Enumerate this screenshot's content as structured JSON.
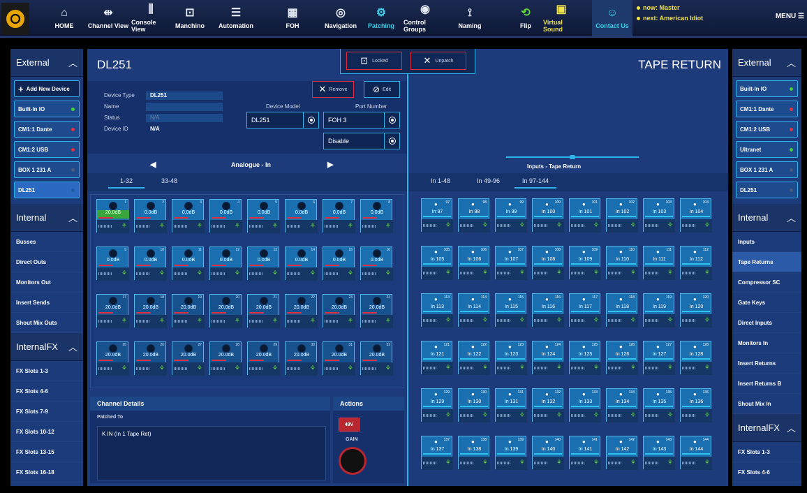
{
  "topbar": {
    "items": [
      {
        "label": "HOME",
        "icon": "home-icon",
        "glyph": "⌂",
        "style": ""
      },
      {
        "label": "Channel View",
        "icon": "channel-view-icon",
        "glyph": "⇹",
        "style": ""
      },
      {
        "label": "Console View",
        "icon": "console-view-icon",
        "glyph": "⫼",
        "style": ""
      },
      {
        "label": "Manchino",
        "icon": "manchino-icon",
        "glyph": "⊡",
        "style": ""
      },
      {
        "label": "Automation",
        "icon": "automation-icon",
        "glyph": "☰",
        "style": ""
      },
      {
        "label": "FOH",
        "icon": "foh-icon",
        "glyph": "▦",
        "style": ""
      },
      {
        "label": "Navigation",
        "icon": "navigation-icon",
        "glyph": "◎",
        "style": ""
      },
      {
        "label": "Patching",
        "icon": "patching-icon",
        "glyph": "⚙",
        "style": "teal"
      },
      {
        "label": "Control Groups",
        "icon": "control-groups-icon",
        "glyph": "◉",
        "style": ""
      },
      {
        "label": "Naming",
        "icon": "naming-icon",
        "glyph": "⟟",
        "style": ""
      },
      {
        "label": "Flip",
        "icon": "flip-icon",
        "glyph": "⟲",
        "style": "green"
      },
      {
        "label": "Virtual Sound",
        "icon": "virtual-sound-icon",
        "glyph": "▣",
        "style": "yellow"
      },
      {
        "label": "Contact Us",
        "icon": "contact-us-icon",
        "glyph": "☺",
        "style": "teal sel"
      }
    ],
    "now_label": "now: Master",
    "next_label": "next: American Idiot",
    "menu_label": "MENU ☰"
  },
  "left_panel": {
    "external_title": "External",
    "add_device": "Add New Device",
    "devices": [
      {
        "label": "Built-In IO",
        "led": "#41d13a"
      },
      {
        "label": "CM1:1 Dante",
        "led": "#e23040"
      },
      {
        "label": "CM1:2 USB",
        "led": "#e23040"
      },
      {
        "label": "BOX 1 231 A",
        "led": "#4a5b7c"
      },
      {
        "label": "DL251",
        "led": "#1f5aa8"
      }
    ],
    "internal_title": "Internal",
    "internal_items": [
      "Busses",
      "Direct Outs",
      "Monitors Out",
      "Insert Sends",
      "Shout Mix Outs"
    ],
    "internalfx_title": "InternalFX",
    "fx_items": [
      "FX Slots 1-3",
      "FX Slots 4-6",
      "FX Slots 7-9",
      "FX Slots 10-12",
      "FX Slots 13-15",
      "FX Slots 16-18"
    ]
  },
  "right_panel": {
    "external_title": "External",
    "devices": [
      {
        "label": "Built-In IO",
        "led": "#41d13a"
      },
      {
        "label": "CM1:1 Dante",
        "led": "#e23040"
      },
      {
        "label": "CM1:2 USB",
        "led": "#e23040"
      },
      {
        "label": "Ultranet",
        "led": "#41d13a"
      },
      {
        "label": "BOX 1 231 A",
        "led": "#4a5b7c"
      },
      {
        "label": "DL251",
        "led": "#4a5b7c"
      }
    ],
    "internal_title": "Internal",
    "internal_items": [
      "Inputs",
      "Tape Returns",
      "Compressor SC",
      "Gate Keys",
      "Direct Inputs",
      "Monitors In",
      "Insert Returns",
      "Insert Returns B",
      "Shout Mix In"
    ],
    "internalfx_title": "InternalFX",
    "fx_items": [
      "FX Slots 1-3",
      "FX Slots 4-6"
    ]
  },
  "center": {
    "title": "DL251",
    "tape_title": "TAPE RETURN",
    "locked": "Locked",
    "unpatch": "Unpatch",
    "remove": "Remove",
    "edit": "Edit",
    "device_type_label": "Device Type",
    "device_type": "DL251",
    "name_label": "Name",
    "status_label": "Status",
    "status": "N/A",
    "device_id_label": "Device ID",
    "device_id": "N/A",
    "device_model_label": "Device Model",
    "device_model": "DL251",
    "port_number_label": "Port Number",
    "port_number": "FOH 3",
    "disable": "Disable",
    "pager": "Analogue - In",
    "tabs": [
      "1-32",
      "33-48"
    ],
    "channels_green": "20.0dB",
    "channels_zero": "0.0dB",
    "channel_details": "Channel Details",
    "patched_to_label": "Patched To",
    "patched_to": "K IN (In 1 Tape Ret)",
    "actions": "Actions",
    "btn48": "48V",
    "gain": "GAIN",
    "right_header": "Inputs - Tape Return",
    "right_tabs": [
      "In 1-48",
      "In 49-96",
      "In 97-144"
    ]
  }
}
